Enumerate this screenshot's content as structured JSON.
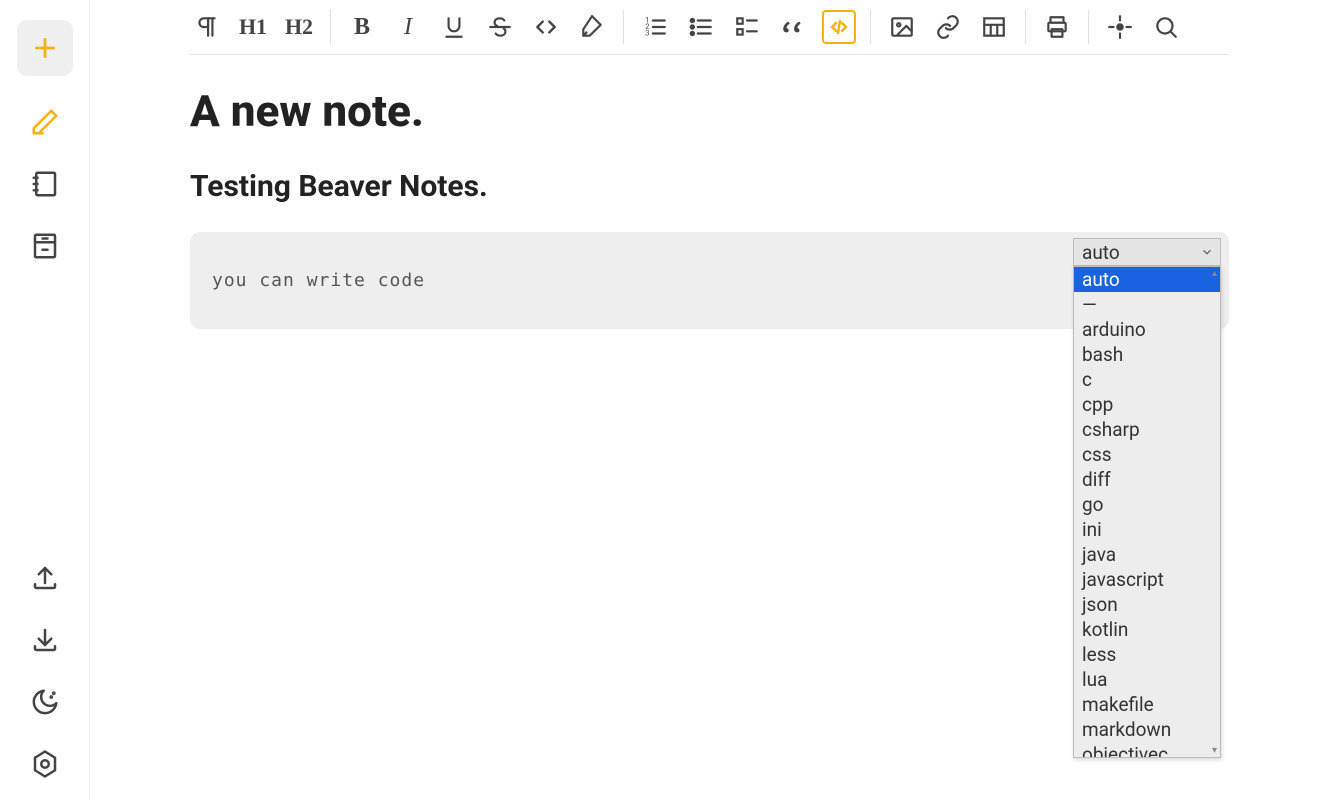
{
  "note": {
    "title": "A new note.",
    "subtitle": "Testing Beaver Notes.",
    "code_content": "you can write code",
    "selected_language": "auto"
  },
  "toolbar": {
    "h1_label": "H1",
    "h2_label": "H2"
  },
  "language_dropdown": {
    "selected": "auto",
    "options": [
      "auto",
      "—",
      "arduino",
      "bash",
      "c",
      "cpp",
      "csharp",
      "css",
      "diff",
      "go",
      "ini",
      "java",
      "javascript",
      "json",
      "kotlin",
      "less",
      "lua",
      "makefile",
      "markdown",
      "objectivec"
    ]
  }
}
